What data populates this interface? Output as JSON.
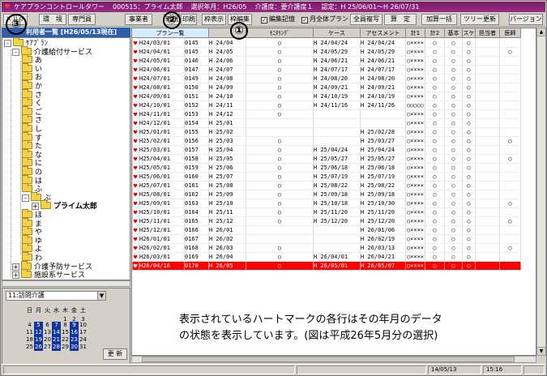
{
  "title_bar": {
    "app_name": "ケアプランコントロールタワー",
    "client": "000515：プライム太郎",
    "selected_month": "選択年月：H26/05",
    "care_level": "介護度：要介護度１",
    "certification": "認定：H 25/06/01～H 26/07/31"
  },
  "toolbar": {
    "close": "✕",
    "refresh_icon": "⟳",
    "env": "環　境",
    "specialist": "専門員",
    "provider": "事業者",
    "register": "新規",
    "print": "印刷",
    "frame_table": "枠表示",
    "frame_edit": "枠編集",
    "edit_memo_check": "✓",
    "edit_memo": "編集記憶",
    "monthly_plan_check": "✓",
    "monthly_plan": "月全体プラン",
    "all_record": "全員複写",
    "calc": "算　定",
    "add_all": "加算一括",
    "tree_update": "ツリー更新",
    "version": "バージョン"
  },
  "left": {
    "header": "利用者一覧 [H26/05/13現在]",
    "tree": [
      {
        "label": "ｹｱﾌﾟﾗﾝ",
        "level": 0,
        "expander": "-"
      },
      {
        "label": "介護給付サービス",
        "level": 1,
        "expander": "-"
      },
      {
        "label": "あ",
        "level": 2
      },
      {
        "label": "い",
        "level": 2
      },
      {
        "label": "お",
        "level": 2
      },
      {
        "label": "か",
        "level": 2
      },
      {
        "label": "さ",
        "level": 2
      },
      {
        "label": "く",
        "level": 2
      },
      {
        "label": "ご",
        "level": 2
      },
      {
        "label": "さ",
        "level": 2
      },
      {
        "label": "し",
        "level": 2
      },
      {
        "label": "す",
        "level": 2
      },
      {
        "label": "た",
        "level": 2
      },
      {
        "label": "な",
        "level": 2
      },
      {
        "label": "に",
        "level": 2
      },
      {
        "label": "の",
        "level": 2
      },
      {
        "label": "は",
        "level": 2
      },
      {
        "label": "ふ",
        "level": 2
      },
      {
        "label": "ぷ",
        "level": 2,
        "expander": "-"
      },
      {
        "label": "プライム太郎",
        "level": 3,
        "expander": "+",
        "bold": true
      },
      {
        "label": "ほ",
        "level": 2
      },
      {
        "label": "ま",
        "level": 2
      },
      {
        "label": "や",
        "level": 2
      },
      {
        "label": "ゆ",
        "level": 2
      },
      {
        "label": "よ",
        "level": 2
      },
      {
        "label": "わ",
        "level": 2
      },
      {
        "label": "介護予防サービス",
        "level": 1,
        "expander": "+"
      },
      {
        "label": "施設系サービス",
        "level": 1,
        "expander": "+"
      }
    ],
    "calendar": {
      "selector": "11:訪問介護",
      "dropdown_icon": "▼",
      "days_header": [
        "日",
        "月",
        "火",
        "水",
        "木",
        "金",
        "土"
      ],
      "weeks": [
        [
          "",
          "",
          "",
          "",
          "1",
          "2",
          "3"
        ],
        [
          "4",
          "5",
          "6",
          "7",
          "8",
          "9",
          "10"
        ],
        [
          "11",
          "12",
          "13",
          "14",
          "15",
          "16",
          "17"
        ],
        [
          "18",
          "19",
          "20",
          "21",
          "22",
          "23",
          "24"
        ],
        [
          "25",
          "26",
          "27",
          "28",
          "29",
          "30",
          "31"
        ]
      ],
      "highlighted": [
        [
          "5",
          "7",
          "9"
        ],
        [
          "12",
          "14",
          "16"
        ],
        [
          "19",
          "21",
          "23"
        ],
        [
          "26",
          "28",
          "30"
        ]
      ],
      "refresh": "更 新"
    }
  },
  "grid": {
    "header_title": "プラン一覧",
    "columns": [
      "",
      "",
      "",
      "",
      "ﾓﾆﾀﾘﾝｸﾞ",
      "ケース",
      "アセスメント",
      "計1",
      "計2",
      "基本",
      "スケ",
      "担当者",
      "医師"
    ],
    "rows": [
      [
        "H24/03/01",
        "0145",
        "H 24/04",
        "○",
        "H 24/04/24",
        "H 24/04/24",
        "○××××",
        "○",
        "○",
        "○",
        "",
        "",
        ""
      ],
      [
        "H24/04/01",
        "0145",
        "H 24/05",
        "○",
        "H 24/05/29",
        "H 24/05/29",
        "○××××",
        "○",
        "○",
        "○",
        "",
        "○",
        ""
      ],
      [
        "H24/05/01",
        "0146",
        "H 24/06",
        "○",
        "H 24/06/21",
        "H 24/06/21",
        "○××××",
        "○",
        "○",
        "○",
        "",
        "",
        ""
      ],
      [
        "H24/06/01",
        "0147",
        "H 24/07",
        "○",
        "H 24/07/17",
        "H 24/07/17",
        "○××××",
        "○",
        "○",
        "○",
        "",
        "",
        ""
      ],
      [
        "H24/07/01",
        "0149",
        "H 24/08",
        "○",
        "H 24/08/20",
        "H 24/08/20",
        "○××××",
        "○",
        "○",
        "○",
        "",
        "",
        ""
      ],
      [
        "H24/08/01",
        "0150",
        "H 24/09",
        "○",
        "H 24/09/21",
        "H 24/09/21",
        "○××××",
        "○",
        "○",
        "○",
        "",
        "",
        ""
      ],
      [
        "H24/09/01",
        "0151",
        "H 24/10",
        "○",
        "H 24/10/19",
        "H 24/10/19",
        "○××××",
        "○",
        "○",
        "○",
        "",
        "",
        ""
      ],
      [
        "H24/10/01",
        "0152",
        "H 24/11",
        "○",
        "H 24/11/16",
        "H 24/11/26",
        "○○○○○",
        "○",
        "○",
        "○",
        "",
        "",
        ""
      ],
      [
        "H24/11/01",
        "0153",
        "H 24/12",
        "○",
        "",
        "",
        "○××××",
        "○",
        "○",
        "○",
        "",
        "",
        ""
      ],
      [
        "H24/12/01",
        "0154",
        "H 25/01",
        "",
        "",
        "",
        "○××××",
        "○",
        "○",
        "○",
        "",
        "",
        ""
      ],
      [
        "H25/01/01",
        "0155",
        "H 25/02",
        "",
        "",
        "H 25/02/28",
        "○××××",
        "○",
        "○",
        "○",
        "",
        "",
        ""
      ],
      [
        "H25/02/01",
        "0156",
        "H 25/03",
        "○",
        "",
        "H 25/03/27",
        "○××××",
        "○",
        "○",
        "○",
        "",
        "○",
        ""
      ],
      [
        "H25/03/01",
        "0157",
        "H 25/04",
        "○",
        "H 25/04/24",
        "H 25/04/24",
        "○××××",
        "○",
        "○",
        "○",
        "",
        "",
        ""
      ],
      [
        "H25/04/01",
        "0158",
        "H 25/05",
        "○",
        "H 25/05/27",
        "H 25/05/27",
        "○××××",
        "○",
        "○",
        "○",
        "",
        "○",
        ""
      ],
      [
        "H25/05/01",
        "0159",
        "H 25/06",
        "○",
        "H 25/06/18",
        "H 25/06/18",
        "○××××",
        "○",
        "○",
        "○",
        "",
        "",
        ""
      ],
      [
        "H25/06/01",
        "0160",
        "H 25/07",
        "○",
        "H 25/07/19",
        "H 25/07/19",
        "○××××",
        "○",
        "○",
        "○",
        "",
        "",
        ""
      ],
      [
        "H25/07/01",
        "0161",
        "H 25/08",
        "○",
        "H 25/08/22",
        "H 25/08/22",
        "○××××",
        "○",
        "○",
        "○",
        "",
        "",
        ""
      ],
      [
        "H25/08/01",
        "0162",
        "H 25/09",
        "○",
        "H 25/09/18",
        "H 25/09/18",
        "○××××",
        "○",
        "○",
        "○",
        "",
        "",
        ""
      ],
      [
        "H25/09/01",
        "0163",
        "H 25/10",
        "○",
        "H 25/10/18",
        "H 25/10/30",
        "○××××",
        "○",
        "○",
        "○",
        "",
        "○",
        ""
      ],
      [
        "H25/10/01",
        "0164",
        "H 25/11",
        "○",
        "H 25/11/20",
        "H 25/11/20",
        "○××××",
        "○",
        "○",
        "○",
        "",
        "",
        ""
      ],
      [
        "H25/11/01",
        "0165",
        "H 25/12",
        "○",
        "H 25/12/20",
        "H 25/12/20",
        "○××××",
        "○",
        "○",
        "○",
        "",
        "○",
        ""
      ],
      [
        "H25/12/01",
        "0166",
        "H 26/01",
        "",
        "",
        "H 26/01/06",
        "○××××",
        "○",
        "○",
        "○",
        "",
        "",
        ""
      ],
      [
        "H26/01/01",
        "0167",
        "H 26/02",
        "",
        "",
        "H 26/02/19",
        "○××××",
        "○",
        "○",
        "○",
        "",
        "",
        ""
      ],
      [
        "H26/02/01",
        "0168",
        "H 26/03",
        "○",
        "",
        "H 26/03/13",
        "○××××",
        "○",
        "○",
        "○",
        "",
        "○",
        ""
      ],
      [
        "H26/03/01",
        "0169",
        "H 26/04",
        "○",
        "H 26/04/01",
        "H 26/04/21",
        "○××××",
        "○",
        "○",
        "○",
        "",
        "",
        ""
      ],
      [
        "H26/04/16",
        "0170",
        "H 26/05",
        "○",
        "H 26/05/01",
        "H 26/05/07",
        "○××××",
        "○",
        "○",
        "○",
        "",
        "",
        ""
      ]
    ],
    "selected_row": 25,
    "heart_icon": "♥"
  },
  "annotations": {
    "circle1": "①",
    "circle2": "②",
    "circle3": "③",
    "note_line1": "表示されているハートマークの各行はその年月のデータ",
    "note_line2": "の状態を表示しています。(図は平成26年5月分の選択)"
  },
  "status": {
    "date": "14/05/13",
    "time": "15:16"
  },
  "colors": {
    "titlebar": "#8a2276",
    "header_blue": "#2f5fa8",
    "selected_row": "#ff0000",
    "heart": "#e00000",
    "calendar_on": "#1034a0"
  }
}
